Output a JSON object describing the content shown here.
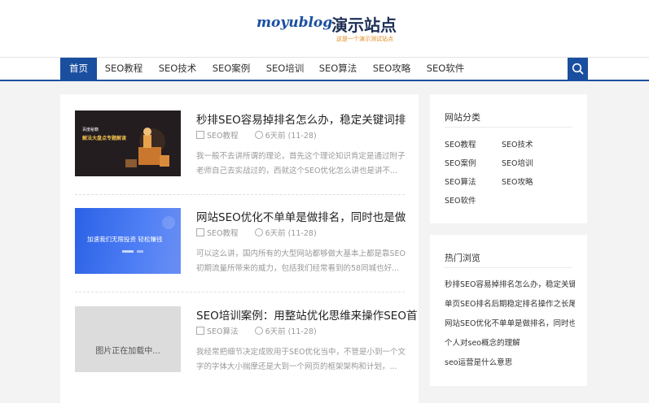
{
  "logo": {
    "main": "moyublog",
    "cn": "演示站点",
    "sub": "这是一个演示测试站点"
  },
  "nav": {
    "items": [
      "首页",
      "SEO教程",
      "SEO技术",
      "SEO案例",
      "SEO培训",
      "SEO算法",
      "SEO攻略",
      "SEO软件"
    ],
    "search_icon": "search-icon"
  },
  "posts": [
    {
      "title": "秒排SEO容易掉排名怎么办，稳定关键词排",
      "category": "SEO教程",
      "time": "6天前 (11-28)",
      "excerpt": "我一般不去讲所谓的理论，首先这个理论知识肯定是通过附子老师自己去实战过的，西就这个SEO优化怎么讲也是讲不...",
      "thumb": {
        "line1": "百度秘籍",
        "line2": "解法大盘点专题解读"
      }
    },
    {
      "title": "网站SEO优化不单单是做排名，同时也是做",
      "category": "SEO教程",
      "time": "6天前 (11-28)",
      "excerpt": "可以这么讲，国内所有的大型网站都够做大基本上都是靠SEO初期流量所带来的威力，包括我们经常看到的58同城也好...",
      "thumb": {
        "line1": "加速我们无限投资 轻松赚钱"
      }
    },
    {
      "title": "SEO培训案例：用整站优化思维来操作SEO首",
      "category": "SEO算法",
      "time": "6天前 (11-28)",
      "excerpt": "我经常把细节决定成败用于SEO优化当中，不管是小到一个文字的字体大小揣摩还是大到一个网页的框架架构和计划，...",
      "thumb": {
        "line1": "图片正在加载中..."
      }
    }
  ],
  "sidebar": {
    "categories_title": "网站分类",
    "categories": [
      "SEO教程",
      "SEO技术",
      "SEO案例",
      "SEO培训",
      "SEO算法",
      "SEO攻略",
      "SEO软件"
    ],
    "hot_title": "热门浏览",
    "hot": [
      "秒排SEO容易掉排名怎么办，稳定关键",
      "单页SEO排名后期稳定排名操作之长尾",
      "网站SEO优化不单单是做排名，同时也",
      "个人对seo概念的理解",
      "seo运营是什么意思"
    ]
  },
  "colors": {
    "accent": "#1a4fa0",
    "logo_sub": "#e08a1e"
  }
}
